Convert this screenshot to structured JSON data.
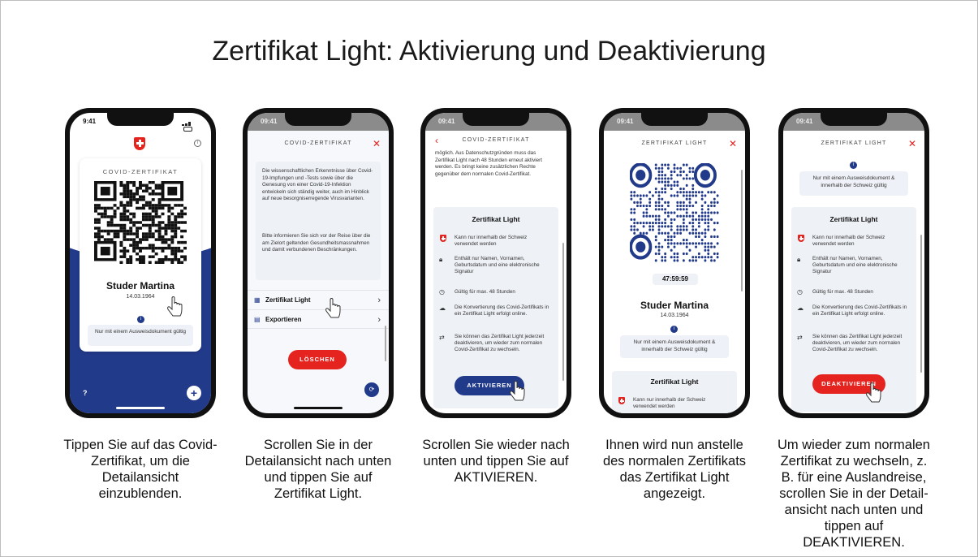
{
  "title": "Zertifikat Light: Aktivierung und Deaktivierung",
  "status_time": "9:41",
  "status_time_dim": "09:41",
  "screens": {
    "s1": {
      "card_label": "COVID-ZERTIFIKAT",
      "name": "Studer Martina",
      "date": "14.03.1964",
      "note": "Nur mit einem Ausweisdokument gültig",
      "help": "?",
      "plus": "+"
    },
    "s2": {
      "header": "COVID-ZERTIFIKAT",
      "para1": "Die wissenschaftlichen Erkenntnisse über Covid-19-Impfungen und -Tests sowie über die Genesung von einer Covid-19-Infektion entwickeln sich ständig weiter, auch im Hinblick auf neue besorgniserregende Virusvarianten.",
      "para2": "Bitte informieren Sie sich vor der Reise über die am Zielort geltenden Gesundheitsmassnahmen und damit verbundenen Beschränkungen.",
      "row1": "Zertifikat Light",
      "row2": "Exportieren",
      "delete_btn": "LÖSCHEN"
    },
    "s3": {
      "header": "COVID-ZERTIFIKAT",
      "para": "möglich. Aus Datenschutzgründen muss das Zertifikat Light nach 48 Stunden erneut aktiviert werden. Es bringt keine zusätzlichen Rechte gegenüber dem normalen Covid-Zertifikat.",
      "panel_title": "Zertifikat Light",
      "features": [
        "Kann nur innerhalb der Schweiz verwendet werden",
        "Enthält nur Namen, Vornamen, Geburtsdatum und eine elektronische Signatur",
        "Gültig für max. 48 Stunden",
        "Die Konvertierung des Covid-Zertifikats in ein Zertifikat Light erfolgt online.",
        "Sie können das Zertifikat Light jederzeit deaktivieren, um wieder zum normalen Covid-Zertifikat zu wechseln."
      ],
      "activate_btn": "AKTIVIEREN"
    },
    "s4": {
      "header": "ZERTIFIKAT LIGHT",
      "timer": "47:59:59",
      "name": "Studer Martina",
      "date": "14.03.1964",
      "note": "Nur mit einem Ausweisdokument & innerhalb der Schweiz gültig",
      "panel_title": "Zertifikat Light",
      "feature": "Kann nur innerhalb der Schweiz verwendet werden"
    },
    "s5": {
      "header": "ZERTIFIKAT LIGHT",
      "note": "Nur mit einem Ausweisdokument & innerhalb der Schweiz gültig",
      "panel_title": "Zertifikat Light",
      "features": [
        "Kann nur innerhalb der Schweiz verwendet werden",
        "Enthält nur Namen, Vornamen, Geburtsdatum und eine elektronische Signatur",
        "Gültig für max. 48 Stunden",
        "Die Konvertierung des Covid-Zertifikats in ein Zertifikat Light erfolgt online.",
        "Sie können das Zertifikat Light jederzeit deaktivieren, um wieder zum normalen Covid-Zertifikat zu wechseln."
      ],
      "deactivate_btn": "DEAKTIVIEREN"
    }
  },
  "captions": [
    "Tippen Sie auf das Covid-Zertifikat, um die Detailansicht einzublenden.",
    "Scrollen Sie in der Detailansicht nach unten und tippen Sie auf Zertifikat Light.",
    "Scrollen Sie wieder nach unten und tippen Sie auf AKTIVIEREN.",
    "Ihnen wird nun anstelle des normalen Zertifikats das Zertifikat Light angezeigt.",
    "Um wieder zum normalen Zertifikat zu wechseln, z. B. für eine Auslandreise, scrollen Sie in der Detail-ansicht nach unten und tippen auf DEAKTIVIEREN."
  ],
  "colors": {
    "brand_red": "#e52420",
    "navy": "#223a8a",
    "panel_gray": "#eef1f6"
  },
  "icons": [
    "swiss-cross-icon",
    "info-icon",
    "close-icon",
    "chevron-right-icon",
    "back-icon",
    "clock-icon",
    "cloud-icon",
    "lock-icon",
    "swap-icon",
    "qr-icon",
    "export-icon",
    "hand-pointer-icon",
    "refresh-icon",
    "plus-icon"
  ]
}
